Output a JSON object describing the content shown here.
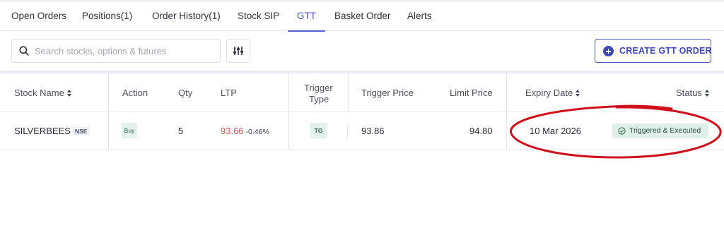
{
  "tabs": [
    {
      "label": "Open Orders"
    },
    {
      "label": "Positions(1)"
    },
    {
      "label": "Order History(1)"
    },
    {
      "label": "Stock SIP"
    },
    {
      "label": "GTT",
      "active": true
    },
    {
      "label": "Basket Order"
    },
    {
      "label": "Alerts"
    }
  ],
  "search": {
    "placeholder": "Search stocks, options & futures",
    "icon": "search-icon"
  },
  "filter": {
    "icon": "sliders-icon"
  },
  "create_button": {
    "label": "CREATE GTT ORDER",
    "icon": "plus-circle-icon"
  },
  "table": {
    "headers": {
      "stock_name": "Stock Name",
      "action": "Action",
      "qty": "Qty",
      "ltp": "LTP",
      "trigger_type_1": "Trigger",
      "trigger_type_2": "Type",
      "trigger_price": "Trigger Price",
      "limit_price": "Limit Price",
      "expiry_date": "Expiry Date",
      "status": "Status"
    },
    "rows": [
      {
        "stock": "SILVERBEES",
        "exchange": "NSE",
        "action": "Buy",
        "qty": "5",
        "ltp": "93.66",
        "ltp_change": "-0.46%",
        "trigger_type": "TG",
        "trigger_price": "93.86",
        "limit_price": "94.80",
        "expiry_date": "10 Mar 2026",
        "status": "Triggered & Executed",
        "status_icon": "check-circle-icon"
      }
    ]
  },
  "colors": {
    "accent": "#4a56c8",
    "ltp_negative": "#d9534f",
    "status_bg": "#dff0e8",
    "annotation": "#d10f1a"
  }
}
